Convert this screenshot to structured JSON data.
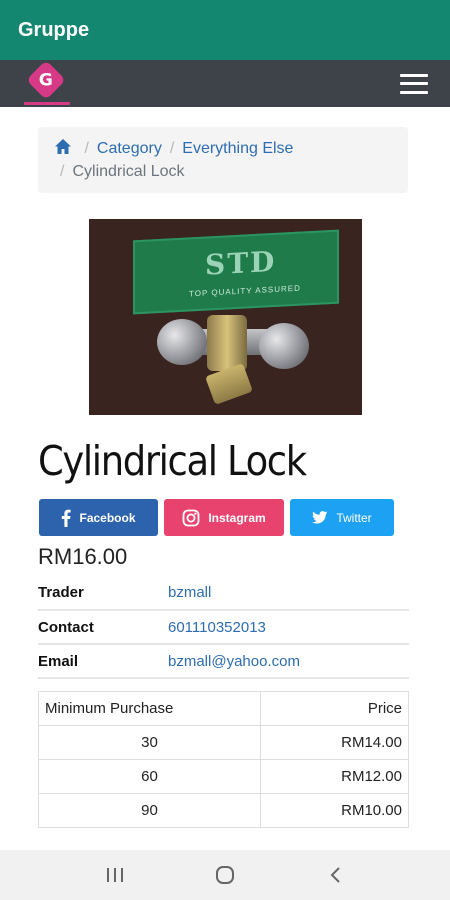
{
  "appbar": {
    "title": "Gruppe"
  },
  "navbar": {
    "logo_icon": "g-logo-icon",
    "menu_icon": "hamburger-menu-icon"
  },
  "breadcrumb": {
    "home_icon": "home-icon",
    "items": [
      {
        "label": "Category"
      },
      {
        "label": "Everything Else"
      }
    ],
    "current": "Cylindrical Lock",
    "separator": "/"
  },
  "product": {
    "image_alt": "STD cylindrical lock photo",
    "image_brand_text": "STD",
    "image_sub_text": "TOP QUALITY ASSURED",
    "title": "Cylindrical Lock",
    "price": "RM16.00"
  },
  "share": {
    "facebook": "Facebook",
    "instagram": "Instagram",
    "twitter": "Twitter"
  },
  "info": {
    "rows": [
      {
        "key": "Trader",
        "value": "bzmall"
      },
      {
        "key": "Contact",
        "value": "601110352013"
      },
      {
        "key": "Email",
        "value": "bzmall@yahoo.com"
      }
    ]
  },
  "tiers": {
    "headers": {
      "min": "Minimum Purchase",
      "price": "Price"
    },
    "rows": [
      {
        "qty": "30",
        "price": "RM14.00"
      },
      {
        "qty": "60",
        "price": "RM12.00"
      },
      {
        "qty": "90",
        "price": "RM10.00"
      }
    ]
  },
  "colors": {
    "appbar": "#13876f",
    "navbar": "#3e4349",
    "link": "#2e6db0",
    "facebook": "#2d63ad",
    "instagram": "#e8436e",
    "twitter": "#1da1f2"
  },
  "system_nav": {
    "recents_icon": "recents-icon",
    "home_icon": "home-circle-icon",
    "back_icon": "back-chevron-icon"
  }
}
